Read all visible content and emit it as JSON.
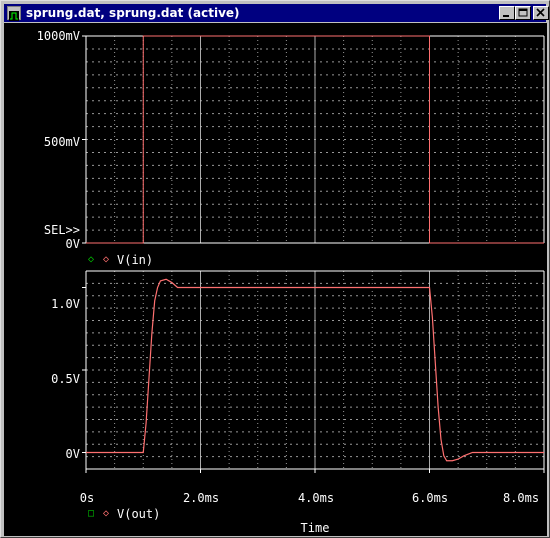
{
  "window": {
    "title": "sprung.dat, sprung.dat (active)",
    "icons": [
      "app-icon",
      "minimize-icon",
      "maximize-icon",
      "close-icon"
    ]
  },
  "colors": {
    "background": "#000000",
    "grid": "#bfbfbf",
    "axis": "#ffffff",
    "trace": "#ff7070",
    "text": "#ffffff",
    "selected_marker": "#00c000",
    "unselected_marker": "#ff7070"
  },
  "top_plot": {
    "y_labels": [
      "1000mV",
      "500mV",
      "0V"
    ],
    "sel_marker": "SEL>>",
    "legend": {
      "label": "V(in)",
      "marker_icon": "diamond-icon"
    }
  },
  "bottom_plot": {
    "y_labels": [
      "1.0V",
      "0.5V",
      "0V"
    ],
    "legend": {
      "label": "V(out)",
      "marker_icon": "square-icon"
    }
  },
  "x_axis": {
    "tick_labels": [
      "0s",
      "2.0ms",
      "4.0ms",
      "6.0ms",
      "8.0ms"
    ],
    "title": "Time"
  },
  "chart_data": [
    {
      "type": "line",
      "series": [
        {
          "name": "V(in)",
          "x_ms": [
            0,
            1.0,
            1.0,
            6.0,
            6.0,
            8.0
          ],
          "y_mV": [
            0,
            0,
            1000,
            1000,
            0,
            0
          ]
        }
      ],
      "xlim_ms": [
        0,
        8
      ],
      "ylim_mV": [
        0,
        1000
      ],
      "grid": true
    },
    {
      "type": "line",
      "series": [
        {
          "name": "V(out)",
          "x_ms": [
            0,
            1.0,
            1.05,
            1.1,
            1.15,
            1.2,
            1.25,
            1.3,
            1.4,
            1.5,
            1.6,
            1.75,
            6.0,
            6.05,
            6.1,
            6.15,
            6.2,
            6.25,
            6.3,
            6.4,
            6.5,
            6.6,
            6.75,
            8.0
          ],
          "y_V": [
            0,
            0,
            0.18,
            0.45,
            0.72,
            0.92,
            1.0,
            1.04,
            1.05,
            1.03,
            1.0,
            1.0,
            1.0,
            0.82,
            0.55,
            0.28,
            0.08,
            -0.02,
            -0.05,
            -0.05,
            -0.04,
            -0.02,
            0.0,
            0.0
          ]
        }
      ],
      "xlim_ms": [
        0,
        8
      ],
      "ylim_V": [
        -0.1,
        1.1
      ],
      "grid": true
    }
  ]
}
